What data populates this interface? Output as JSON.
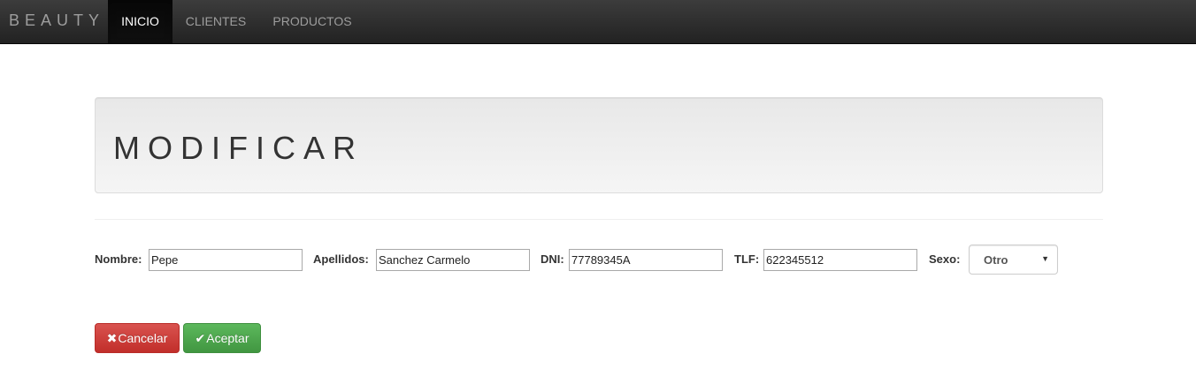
{
  "navbar": {
    "brand": "BEAUTY",
    "items": [
      {
        "label": "INICIO",
        "active": true
      },
      {
        "label": "CLIENTES",
        "active": false
      },
      {
        "label": "PRODUCTOS",
        "active": false
      }
    ]
  },
  "jumbotron": {
    "title": "MODIFICAR"
  },
  "form": {
    "nombre": {
      "label": "Nombre:",
      "value": "Pepe"
    },
    "apellidos": {
      "label": "Apellidos:",
      "value": "Sanchez Carmelo"
    },
    "dni": {
      "label": "DNI:",
      "value": "77789345A"
    },
    "tlf": {
      "label": "TLF:",
      "value": "622345512"
    },
    "sexo": {
      "label": "Sexo:",
      "selected": "Otro",
      "icon": "chevron-down-icon"
    }
  },
  "actions": {
    "cancel": {
      "label": "Cancelar",
      "icon": "x-icon",
      "glyph": "✖",
      "color": "#d9534f"
    },
    "accept": {
      "label": "Aceptar",
      "icon": "check-icon",
      "glyph": "✔",
      "color": "#5cb85c"
    }
  }
}
